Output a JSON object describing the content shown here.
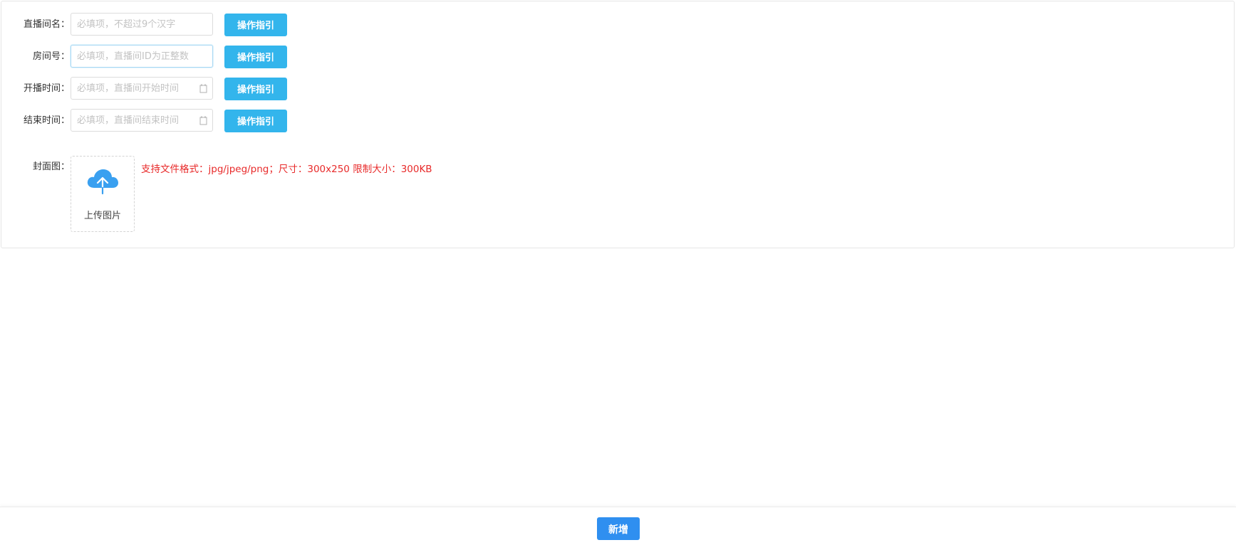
{
  "form": {
    "room_name": {
      "label": "直播间名：",
      "placeholder": "必填项，不超过9个汉字",
      "value": "",
      "guide_label": "操作指引"
    },
    "room_id": {
      "label": "房间号：",
      "placeholder": "必填项，直播间ID为正整数",
      "value": "",
      "guide_label": "操作指引"
    },
    "start_time": {
      "label": "开播时间：",
      "placeholder": "必填项，直播间开始时间",
      "value": "",
      "guide_label": "操作指引"
    },
    "end_time": {
      "label": "结束时间：",
      "placeholder": "必填项，直播间结束时间",
      "value": "",
      "guide_label": "操作指引"
    },
    "cover": {
      "label": "封面图：",
      "upload_label": "上传图片",
      "upload_icon": "cloud-upload-icon",
      "tip": "支持文件格式：jpg/jpeg/png；尺寸：300x250 限制大小：300KB"
    }
  },
  "footer": {
    "submit_label": "新增"
  },
  "colors": {
    "guide_button": "#33b5ec",
    "submit_button": "#2f8ff0",
    "tip_text": "#e82a2a",
    "upload_icon": "#3aa0f0"
  }
}
